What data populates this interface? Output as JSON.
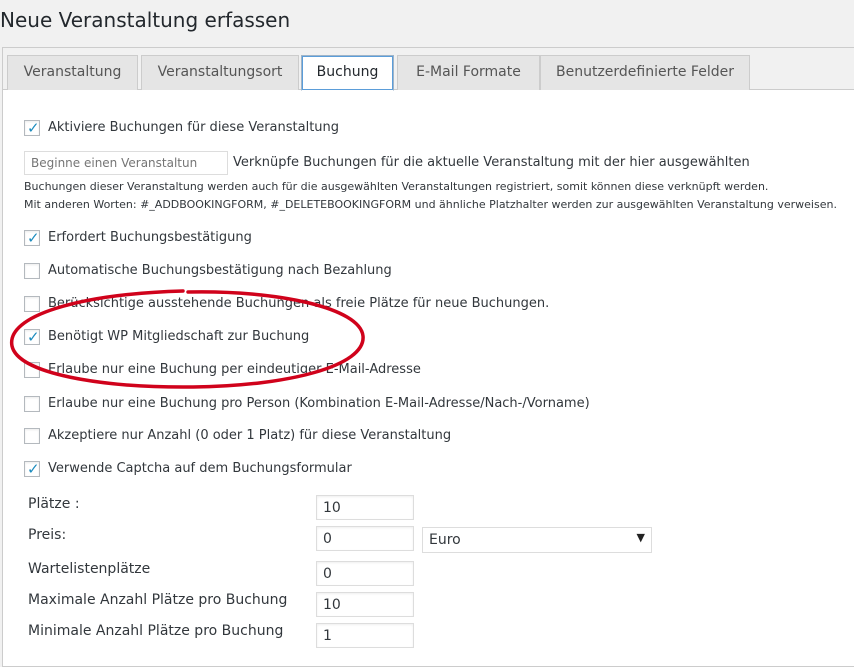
{
  "page_title": "Neue Veranstaltung erfassen",
  "tabs": [
    {
      "label": "Veranstaltung"
    },
    {
      "label": "Veranstaltungsort"
    },
    {
      "label": "Buchung"
    },
    {
      "label": "E-Mail Formate"
    },
    {
      "label": "Benutzerdefinierte Felder"
    }
  ],
  "active_tab": "Buchung",
  "activate": {
    "label": "Aktiviere Buchungen für diese Veranstaltung",
    "checked": true
  },
  "linked_event": {
    "placeholder": "Beginne einen Veranstaltun",
    "label": "Verknüpfe Buchungen für die aktuelle Veranstaltung mit der hier ausgewählten",
    "help1": "Buchungen dieser Veranstaltung werden auch für die ausgewählten Veranstaltungen registriert, somit können diese verknüpft werden.",
    "help2": "Mit anderen Worten: #_ADDBOOKINGFORM, #_DELETEBOOKINGFORM und ähnliche Platzhalter werden zur ausgewählten Veranstaltung verweisen."
  },
  "options": [
    {
      "label": "Erfordert Buchungsbestätigung",
      "checked": true
    },
    {
      "label": "Automatische Buchungsbestätigung nach Bezahlung",
      "checked": false
    },
    {
      "label": "Berücksichtige ausstehende Buchungen als freie Plätze für neue Buchungen.",
      "checked": false
    },
    {
      "label": "Benötigt WP Mitgliedschaft zur Buchung",
      "checked": true
    },
    {
      "label": "Erlaube nur eine Buchung per eindeutiger E-Mail-Adresse",
      "checked": false
    },
    {
      "label": "Erlaube nur eine Buchung pro Person (Kombination E-Mail-Adresse/Nach-/Vorname)",
      "checked": false
    },
    {
      "label": "Akzeptiere nur Anzahl (0 oder 1 Platz) für diese Veranstaltung",
      "checked": false
    },
    {
      "label": "Verwende Captcha auf dem Buchungsformular",
      "checked": true
    }
  ],
  "fields": {
    "seats": {
      "label": "Plätze :",
      "value": "10"
    },
    "price": {
      "label": "Preis:",
      "value": "0",
      "currency": "Euro"
    },
    "waitlist": {
      "label": "Wartelistenplätze",
      "value": "0"
    },
    "max_per_booking": {
      "label": "Maximale Anzahl Plätze pro Buchung",
      "value": "10"
    },
    "min_per_booking": {
      "label": "Minimale Anzahl Plätze pro Buchung",
      "value": "1"
    }
  },
  "colors": {
    "annotation": "#d0021b",
    "check": "#1e8cbe",
    "active_tab_border": "#5b9dd9"
  }
}
